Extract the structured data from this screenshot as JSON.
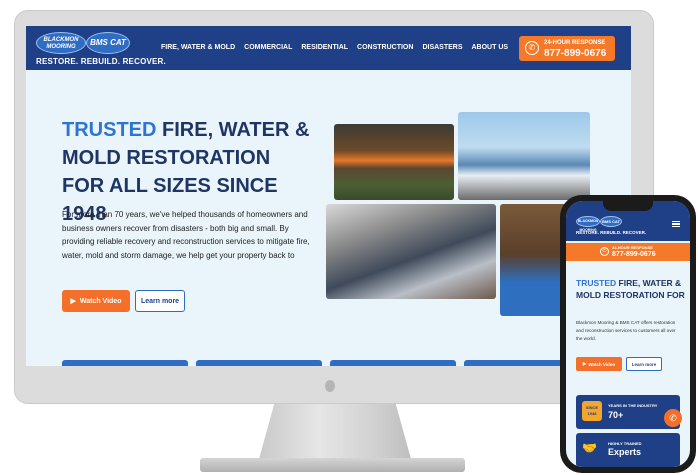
{
  "desktop": {
    "logo_primary": "BLACKMON MOORING",
    "logo_secondary": "BMS CAT",
    "tagline": "RESTORE. REBUILD. RECOVER.",
    "menu": [
      "FIRE, WATER & MOLD",
      "COMMERCIAL",
      "RESIDENTIAL",
      "CONSTRUCTION",
      "DISASTERS",
      "ABOUT US"
    ],
    "response_label": "24-HOUR RESPONSE",
    "response_phone": "877-899-0676",
    "hero_highlight": "TRUSTED",
    "hero_rest": "FIRE, WATER & MOLD RESTORATION FOR ALL SIZES SINCE 1948",
    "hero_body": "For more than 70 years, we've helped thousands of homeowners and business owners recover from disasters - both big and small. By providing reliable recovery and reconstruction services to mitigate fire, water, mold and storm damage, we help get your property back to",
    "watch_label": "Watch Video",
    "learn_label": "Learn more"
  },
  "mobile": {
    "logo_primary": "BLACKMON MOORING",
    "logo_secondary": "BMS CAT",
    "tagline": "RESTORE. REBUILD. RECOVER.",
    "response_label": "24-HOUR RESPONSE",
    "response_phone": "877-899-0676",
    "hero_highlight": "TRUSTED",
    "hero_rest": "FIRE, WATER & MOLD RESTORATION FOR",
    "body": "Blackmon Mooring & BMS CAT offers restoration and reconstruction services to customers all over the world.",
    "watch_label": "Watch Video",
    "learn_label": "Learn more",
    "stat1_badge": "SINCE 1948",
    "stat1_label": "YEARS IN THE INDUSTRY",
    "stat1_value": "70+",
    "stat2_label": "HIGHLY TRAINED",
    "stat2_value": "Experts"
  },
  "colors": {
    "navy": "#1f3f86",
    "orange": "#f47a2a",
    "hero_blue": "#2f74d0",
    "background": "#eaf4fb"
  }
}
